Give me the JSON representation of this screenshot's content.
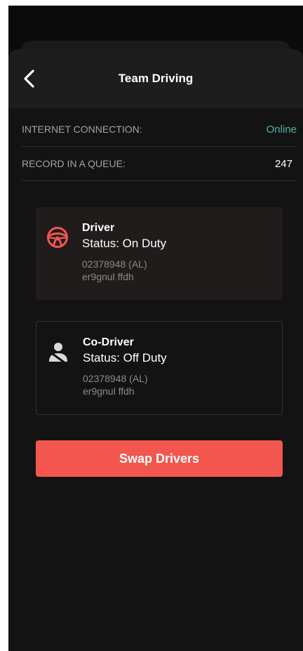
{
  "header": {
    "title": "Team Driving",
    "back_icon": "chevron-left-icon"
  },
  "status_info": {
    "internet_label": "INTERNET CONNECTION:",
    "internet_value": "Online",
    "queue_label": "RECORD IN A QUEUE:",
    "queue_value": "247"
  },
  "driver": {
    "icon": "steering-wheel-icon",
    "role": "Driver",
    "status": "Status: On Duty",
    "code": "02378948 (AL)",
    "name": "er9gnul ffdh"
  },
  "codriver": {
    "icon": "user-off-icon",
    "role": "Co-Driver",
    "status": "Status: Off Duty",
    "code": "02378948 (AL)",
    "name": "er9gnul ffdh"
  },
  "actions": {
    "swap_label": "Swap Drivers"
  },
  "colors": {
    "accent": "#f2564e",
    "online": "#4fb3a6",
    "background": "#131313"
  }
}
